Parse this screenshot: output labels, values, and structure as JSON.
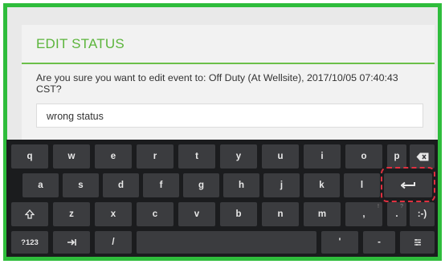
{
  "dialog": {
    "title": "EDIT STATUS",
    "message_line1": "Are you sure you want to edit event to: Off Duty (At Wellsite), 2017/10/05 07:40:43",
    "message_line2": "CST?",
    "reason_value": "wrong status"
  },
  "keyboard": {
    "row1": [
      "q",
      "w",
      "e",
      "r",
      "t",
      "y",
      "u",
      "i",
      "o",
      "p"
    ],
    "row2": [
      "a",
      "s",
      "d",
      "f",
      "g",
      "h",
      "j",
      "k",
      "l"
    ],
    "row3": [
      "z",
      "x",
      "c",
      "v",
      "b",
      "n",
      "m",
      ",",
      "."
    ],
    "row3_hints": [
      "",
      "",
      "",
      "",
      "",
      "",
      "",
      "!",
      "?"
    ],
    "smiley": ":-)",
    "symbols": "?123",
    "slash": "/",
    "apostrophe": "'",
    "dash": "-",
    "icons": {
      "backspace": "backspace-icon",
      "enter": "enter-icon",
      "shift": "shift-icon",
      "tab": "tab-icon",
      "settings": "keyboard-settings-icon"
    },
    "highlight_color": "#e03040"
  },
  "frame": {
    "border_color": "#2fbd3c",
    "accent": "#5cb53c"
  }
}
